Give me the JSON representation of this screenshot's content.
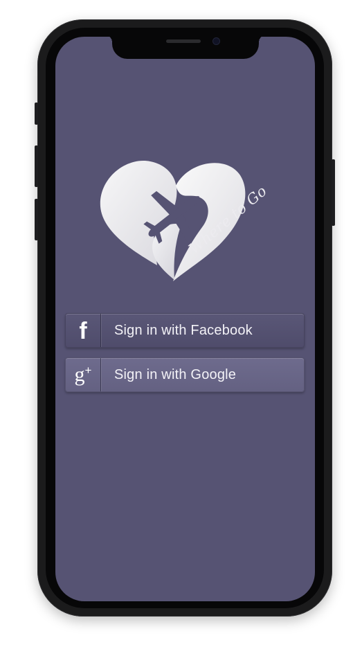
{
  "app": {
    "name": "Where to Go"
  },
  "logo": {
    "icon": "heart-airplane-icon",
    "text": "Where to Go"
  },
  "buttons": {
    "facebook": {
      "label": "Sign in with Facebook",
      "icon": "facebook-icon",
      "glyph": "f"
    },
    "google": {
      "label": "Sign in with Google",
      "icon": "google-plus-icon",
      "glyph": "g",
      "glyph_sup": "+"
    }
  },
  "colors": {
    "screen_background": "#565373",
    "facebook_button": "#54516f",
    "google_button": "#6a6789",
    "logo_white": "#f2f2f4"
  }
}
